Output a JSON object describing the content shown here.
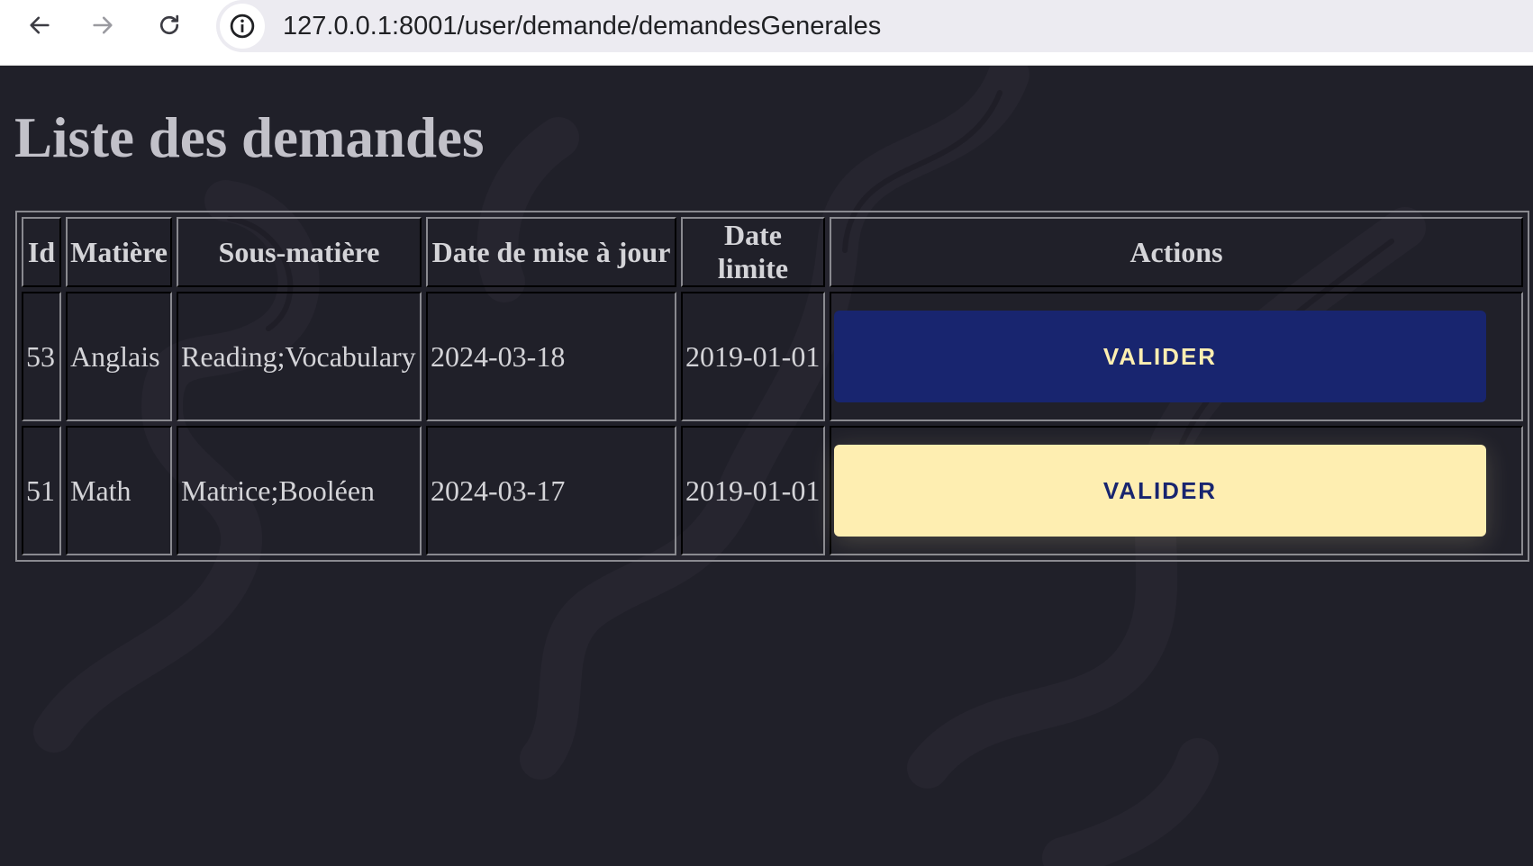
{
  "browser": {
    "url": "127.0.0.1:8001/user/demande/demandesGenerales"
  },
  "page": {
    "title": "Liste des demandes"
  },
  "table": {
    "headers": {
      "id": "Id",
      "matiere": "Matière",
      "sous_matiere": "Sous-matière",
      "date_maj": "Date de mise à jour",
      "date_limite": "Date limite",
      "actions": "Actions"
    },
    "rows": [
      {
        "id": "53",
        "matiere": "Anglais",
        "sous_matiere": "Reading;Vocabulary",
        "date_maj": "2024-03-18",
        "date_limite": "2019-01-01",
        "action_label": "VALIDER"
      },
      {
        "id": "51",
        "matiere": "Math",
        "sous_matiere": "Matrice;Booléen",
        "date_maj": "2024-03-17",
        "date_limite": "2019-01-01",
        "action_label": "VALIDER"
      }
    ]
  },
  "colors": {
    "background": "#202029",
    "primary_button": "#18256f",
    "secondary_button": "#feeeb1"
  }
}
